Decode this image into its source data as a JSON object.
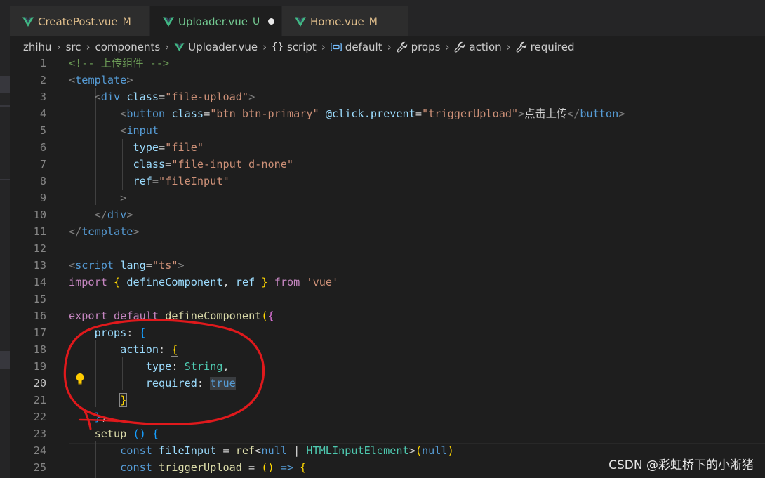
{
  "tabs": [
    {
      "name": "CreatePost.vue",
      "status": "M"
    },
    {
      "name": "Uploader.vue",
      "status": "U"
    },
    {
      "name": "Home.vue",
      "status": "M"
    }
  ],
  "breadcrumb": [
    "zhihu",
    "src",
    "components",
    "Uploader.vue",
    "script",
    "default",
    "props",
    "action",
    "required"
  ],
  "line_numbers": [
    "1",
    "2",
    "3",
    "4",
    "5",
    "6",
    "7",
    "8",
    "9",
    "10",
    "11",
    "12",
    "13",
    "14",
    "15",
    "16",
    "17",
    "18",
    "19",
    "20",
    "21",
    "22",
    "23",
    "24",
    "25"
  ],
  "code": {
    "l1": "<!-- 上传组件 -->",
    "l2_open": "<",
    "l2_tag": "template",
    "l2_close": ">",
    "l3_open": "<",
    "l3_tag": "div",
    "l3_attr": "class",
    "l3_eq": "=",
    "l3_val": "\"file-upload\"",
    "l3_close": ">",
    "l4_open": "<",
    "l4_tag": "button",
    "l4_attr1": "class",
    "l4_eq1": "=",
    "l4_val1": "\"btn btn-primary\"",
    "l4_attr2": "@click.prevent",
    "l4_eq2": "=",
    "l4_val2": "\"triggerUpload\"",
    "l4_gt": ">",
    "l4_text": "点击上传",
    "l4_endopen": "</",
    "l4_endtag": "button",
    "l4_endclose": ">",
    "l5_open": "<",
    "l5_tag": "input",
    "l6_attr": "type",
    "l6_eq": "=",
    "l6_val": "\"file\"",
    "l7_attr": "class",
    "l7_eq": "=",
    "l7_val": "\"file-input d-none\"",
    "l8_attr": "ref",
    "l8_eq": "=",
    "l8_val": "\"fileInput\"",
    "l9": ">",
    "l10_open": "</",
    "l10_tag": "div",
    "l10_close": ">",
    "l11_open": "</",
    "l11_tag": "template",
    "l11_close": ">",
    "l13_open": "<",
    "l13_tag": "script",
    "l13_attr": "lang",
    "l13_eq": "=",
    "l13_val": "\"ts\"",
    "l13_close": ">",
    "l14_import": "import",
    "l14_b1": "{",
    "l14_names": " defineComponent",
    "l14_comma": ",",
    "l14_ref": " ref ",
    "l14_b2": "}",
    "l14_from": "from",
    "l14_str": "'vue'",
    "l16_export": "export",
    "l16_default": "default",
    "l16_fn": "defineComponent",
    "l16_p": "(",
    "l16_b": "{",
    "l17_prop": "props",
    "l17_colon": ": ",
    "l17_b": "{",
    "l18_prop": "action",
    "l18_colon": ": ",
    "l18_b": "{",
    "l19_prop": "type",
    "l19_colon": ": ",
    "l19_type": "String",
    "l19_comma": ",",
    "l20_prop": "required",
    "l20_colon": ": ",
    "l20_val": "true",
    "l21_b": "}",
    "l22_b": "}",
    "l22_comma": ",",
    "l23_fn": "setup",
    "l23_p": "()",
    "l23_b": "{",
    "l24_const": "const",
    "l24_var": "fileInput",
    "l24_eq": " = ",
    "l24_fn": "ref",
    "l24_lt": "<",
    "l24_null": "null",
    "l24_bar": " | ",
    "l24_type": "HTMLInputElement",
    "l24_gt": ">",
    "l24_p1": "(",
    "l24_null2": "null",
    "l24_p2": ")",
    "l25_const": "const",
    "l25_var": "triggerUpload",
    "l25_eq": " = ",
    "l25_p": "()",
    "l25_arrow": " => ",
    "l25_b": "{"
  },
  "watermark": "CSDN @彩虹桥下的小淅猪",
  "colors": {
    "vue_green": "#41b883",
    "annotation_red": "#e0191c",
    "modified": "#e2c08d",
    "untracked": "#73c991"
  }
}
